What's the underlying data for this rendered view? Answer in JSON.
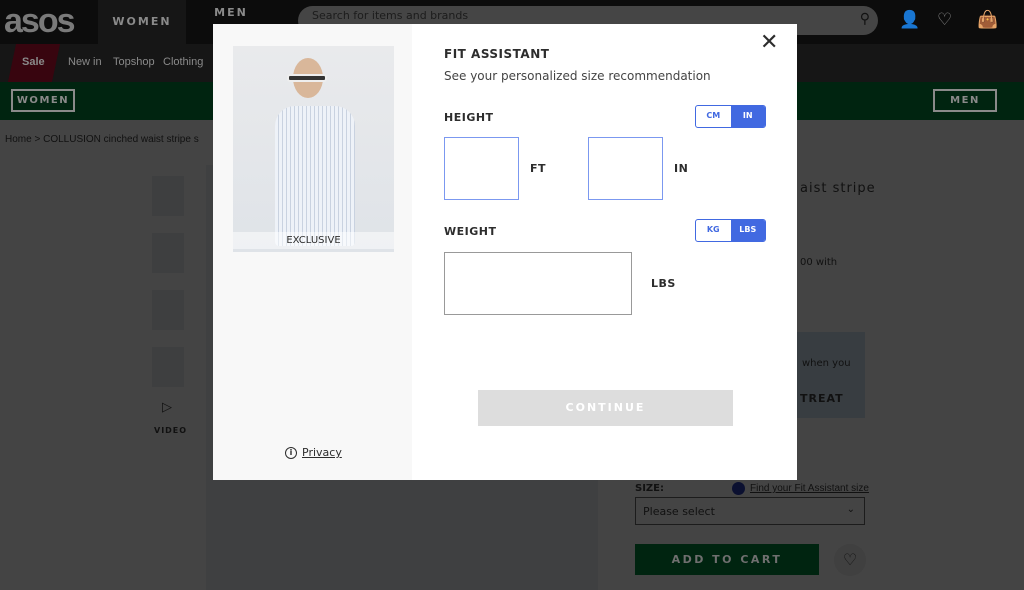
{
  "header": {
    "logo": "asos",
    "tabs": [
      "WOMEN",
      "MEN"
    ],
    "search_placeholder": "Search for items and brands",
    "icons": [
      "search-icon",
      "account-icon",
      "heart-icon",
      "bag-icon"
    ]
  },
  "nav": {
    "items": [
      "Sale",
      "New in",
      "Topshop",
      "Clothing"
    ]
  },
  "banner": {
    "women": "WOMEN",
    "men": "MEN"
  },
  "breadcrumb": {
    "home": "Home",
    "sep": ">",
    "current": "COLLUSION cinched waist stripe s"
  },
  "product": {
    "title_fragment": "aist stripe",
    "promo_fragment": "00 with",
    "promo_text": "when you",
    "promo_cta": "TREAT",
    "video": "VIDEO",
    "size_label": "SIZE:",
    "fit_link": "Find your Fit Assistant size",
    "size_select": "Please select",
    "add_to_cart": "ADD TO CART"
  },
  "modal": {
    "title": "FIT ASSISTANT",
    "subtitle": "See your personalized size recommendation",
    "badge": "EXCLUSIVE",
    "privacy": "Privacy",
    "height": {
      "label": "HEIGHT",
      "units": [
        "CM",
        "IN"
      ],
      "selected": "IN",
      "ft_value": "",
      "in_value": "",
      "ft_label": "FT",
      "in_label": "IN"
    },
    "weight": {
      "label": "WEIGHT",
      "units": [
        "KG",
        "LBS"
      ],
      "selected": "LBS",
      "value": "",
      "unit_label": "LBS"
    },
    "continue": "CONTINUE"
  },
  "colors": {
    "accent": "#4169e1",
    "sale": "#d01345",
    "brand_green": "#018849"
  }
}
